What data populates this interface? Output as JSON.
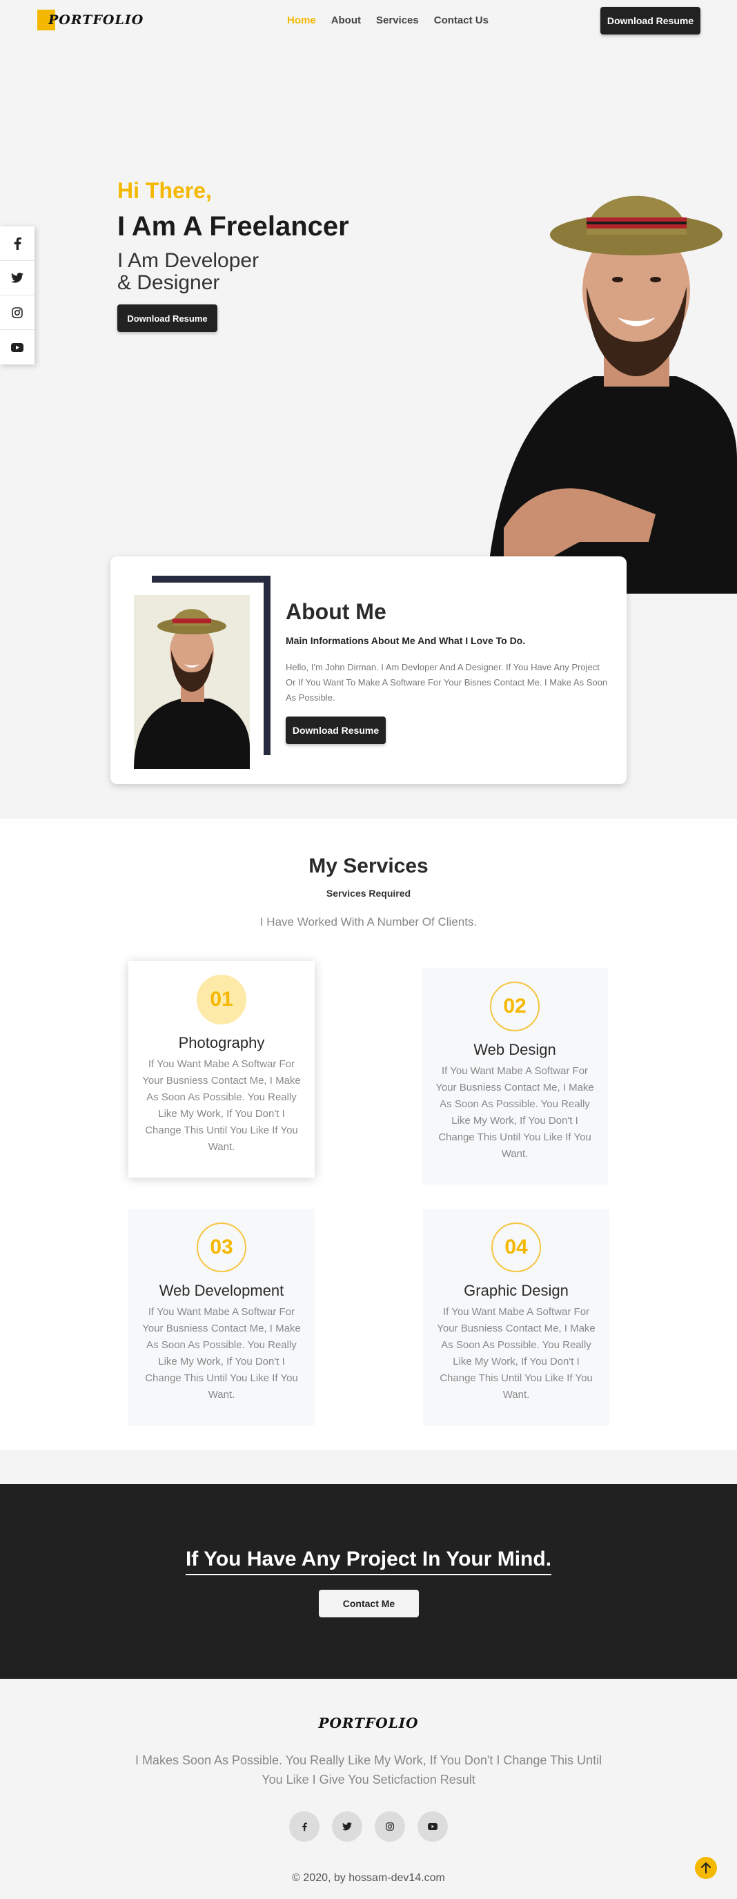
{
  "brand": {
    "logo_letter": "P",
    "logo_text": "ORTFOLIO",
    "accent": "#f5b800",
    "dark": "#222222"
  },
  "nav": {
    "links": [
      "Home",
      "About",
      "Services",
      "Contact Us"
    ],
    "active": "Home",
    "cta": "Download Resume"
  },
  "social": [
    "facebook-icon",
    "twitter-icon",
    "instagram-icon",
    "youtube-icon"
  ],
  "hero": {
    "greeting": "Hi There,",
    "title": "I Am A Freelancer",
    "subtitle_line1": "I Am Developer",
    "subtitle_line2": "& Designer",
    "button": "Download Resume"
  },
  "about": {
    "title": "About Me",
    "subtitle": "Main Informations About Me And What I Love To Do.",
    "text": "Hello, I'm John Dirman. I Am Devloper And A Designer. If You Have Any Project Or If You Want To Make A Software For Your Bisnes Contact Me. I Make As Soon As Possible.",
    "button": "Download Resume"
  },
  "services": {
    "title": "My Services",
    "subtitle": "Services Required",
    "description": "I Have Worked With A Number Of Clients.",
    "items": [
      {
        "number": "01",
        "title": "Photography",
        "text": "If You Want Mabe A Softwar For Your Busniess Contact Me, I Make As Soon As Possible. You Really Like My Work, If You Don't I Change This Until You Like If You Want."
      },
      {
        "number": "02",
        "title": "Web Design",
        "text": "If You Want Mabe A Softwar For Your Busniess Contact Me, I Make As Soon As Possible. You Really Like My Work, If You Don't I Change This Until You Like If You Want."
      },
      {
        "number": "03",
        "title": "Web Development",
        "text": "If You Want Mabe A Softwar For Your Busniess Contact Me, I Make As Soon As Possible. You Really Like My Work, If You Don't I Change This Until You Like If You Want."
      },
      {
        "number": "04",
        "title": "Graphic Design",
        "text": "If You Want Mabe A Softwar For Your Busniess Contact Me, I Make As Soon As Possible. You Really Like My Work, If You Don't I Change This Until You Like If You Want."
      }
    ]
  },
  "cta": {
    "title": "If You Have Any Project In Your Mind.",
    "button": "Contact Me"
  },
  "footer": {
    "logo": "PORTFOLIO",
    "text": "I Makes Soon As Possible. You Really Like My Work, If You Don't I Change This Until You Like I Give You Seticfaction Result",
    "social": [
      "facebook-icon",
      "twitter-icon",
      "instagram-icon",
      "youtube-icon"
    ],
    "copyright": "© 2020, by hossam-dev14.com"
  }
}
